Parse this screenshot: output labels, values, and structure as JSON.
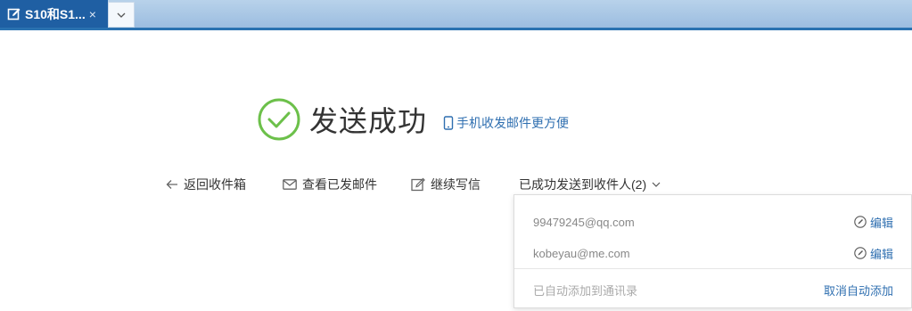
{
  "tab": {
    "title": "S10和S1...",
    "close_glyph": "×",
    "more_glyph": "⌄"
  },
  "success": {
    "title": "发送成功",
    "mobile_link": "手机收发邮件更方便",
    "color": "#6cc04a"
  },
  "actions": {
    "back": "返回收件箱",
    "view_sent": "查看已发邮件",
    "continue_write": "继续写信",
    "recipients": "已成功发送到收件人(2)"
  },
  "recipients_dropdown": {
    "recipients": [
      {
        "email": "99479245@qq.com",
        "edit_label": "编辑"
      },
      {
        "email": "kobeyau@me.com",
        "edit_label": "编辑"
      }
    ],
    "auto_added_text": "已自动添加到通讯录",
    "cancel_auto_label": "取消自动添加"
  },
  "colors": {
    "tab_active": "#1f5fa3",
    "link": "#2f6fb0",
    "accent_border": "#2a72b0"
  },
  "icons": [
    "edit-icon",
    "close-icon",
    "chevron-down-icon",
    "check-circle-icon",
    "mobile-phone-icon",
    "arrow-left-icon",
    "envelope-icon",
    "compose-icon",
    "pencil-circle-icon"
  ]
}
